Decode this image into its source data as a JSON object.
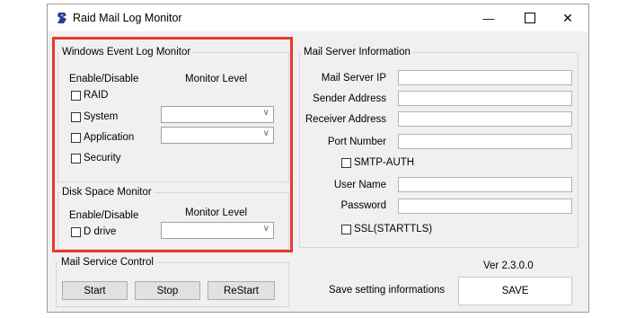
{
  "window": {
    "title": "Raid Mail Log Monitor",
    "minimize_glyph": "—",
    "close_glyph": "✕",
    "icon": "raid-app-icon"
  },
  "event_log": {
    "title": "Windows Event Log Monitor",
    "enable_header": "Enable/Disable",
    "level_header": "Monitor Level",
    "items": [
      {
        "label": "RAID",
        "checked": false
      },
      {
        "label": "System",
        "checked": false,
        "level": ""
      },
      {
        "label": "Application",
        "checked": false,
        "level": ""
      },
      {
        "label": "Security",
        "checked": false
      }
    ]
  },
  "disk": {
    "title": "Disk Space Monitor",
    "enable_header": "Enable/Disable",
    "level_header": "Monitor Level",
    "drive_label": "D drive",
    "drive_checked": false,
    "level": ""
  },
  "mail_server": {
    "title": "Mail Server Information",
    "ip_label": "Mail Server IP",
    "ip_value": "",
    "sender_label": "Sender Address",
    "sender_value": "",
    "receiver_label": "Receiver Address",
    "receiver_value": "",
    "port_label": "Port Number",
    "port_value": "",
    "smtp_auth_label": "SMTP-AUTH",
    "smtp_auth_checked": false,
    "user_label": "User Name",
    "user_value": "",
    "password_label": "Password",
    "password_value": "",
    "ssl_label": "SSL(STARTTLS)",
    "ssl_checked": false
  },
  "service": {
    "title": "Mail Service Control",
    "start": "Start",
    "stop": "Stop",
    "restart": "ReStart"
  },
  "footer": {
    "version": "Ver 2.3.0.0",
    "save_text": "Save setting informations",
    "save_button": "SAVE"
  },
  "colors": {
    "highlight": "#e8392f",
    "window_bg": "#f0f0f0",
    "icon_blue": "#2b3a8f"
  }
}
